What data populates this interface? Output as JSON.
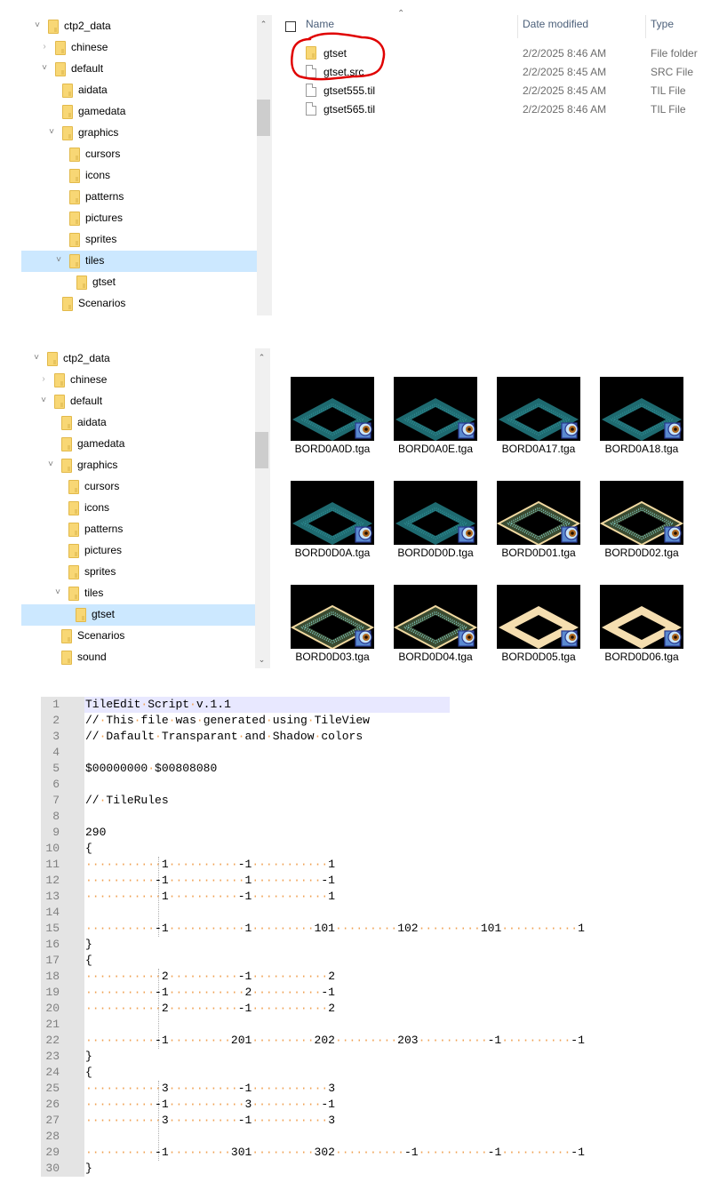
{
  "explorer1": {
    "tree": [
      {
        "label": "ctp2_data",
        "depth": 0,
        "chevron": "expanded"
      },
      {
        "label": "chinese",
        "depth": 1,
        "chevron": "collapsed"
      },
      {
        "label": "default",
        "depth": 1,
        "chevron": "expanded"
      },
      {
        "label": "aidata",
        "depth": 2,
        "chevron": "none"
      },
      {
        "label": "gamedata",
        "depth": 2,
        "chevron": "none"
      },
      {
        "label": "graphics",
        "depth": 2,
        "chevron": "expanded"
      },
      {
        "label": "cursors",
        "depth": 3,
        "chevron": "none"
      },
      {
        "label": "icons",
        "depth": 3,
        "chevron": "none"
      },
      {
        "label": "patterns",
        "depth": 3,
        "chevron": "none"
      },
      {
        "label": "pictures",
        "depth": 3,
        "chevron": "none"
      },
      {
        "label": "sprites",
        "depth": 3,
        "chevron": "none"
      },
      {
        "label": "tiles",
        "depth": 3,
        "chevron": "expanded",
        "selected": true
      },
      {
        "label": "gtset",
        "depth": 4,
        "chevron": "none"
      },
      {
        "label": "Scenarios",
        "depth": 2,
        "chevron": "none"
      }
    ],
    "columns": {
      "name": "Name",
      "date": "Date modified",
      "type": "Type"
    },
    "files": [
      {
        "name": "gtset",
        "date": "2/2/2025 8:46 AM",
        "type": "File folder",
        "icon": "folder-icon"
      },
      {
        "name": "gtset.src",
        "date": "2/2/2025 8:45 AM",
        "type": "SRC File",
        "icon": "file-icon"
      },
      {
        "name": "gtset555.til",
        "date": "2/2/2025 8:45 AM",
        "type": "TIL File",
        "icon": "file-icon"
      },
      {
        "name": "gtset565.til",
        "date": "2/2/2025 8:46 AM",
        "type": "TIL File",
        "icon": "file-icon"
      }
    ],
    "annotation": "red hand-drawn circle around gtset and gtset.src"
  },
  "explorer2": {
    "tree": [
      {
        "label": "ctp2_data",
        "depth": 0,
        "chevron": "expanded"
      },
      {
        "label": "chinese",
        "depth": 1,
        "chevron": "collapsed"
      },
      {
        "label": "default",
        "depth": 1,
        "chevron": "expanded"
      },
      {
        "label": "aidata",
        "depth": 2,
        "chevron": "none"
      },
      {
        "label": "gamedata",
        "depth": 2,
        "chevron": "none"
      },
      {
        "label": "graphics",
        "depth": 2,
        "chevron": "expanded"
      },
      {
        "label": "cursors",
        "depth": 3,
        "chevron": "none"
      },
      {
        "label": "icons",
        "depth": 3,
        "chevron": "none"
      },
      {
        "label": "patterns",
        "depth": 3,
        "chevron": "none"
      },
      {
        "label": "pictures",
        "depth": 3,
        "chevron": "none"
      },
      {
        "label": "sprites",
        "depth": 3,
        "chevron": "none"
      },
      {
        "label": "tiles",
        "depth": 3,
        "chevron": "expanded"
      },
      {
        "label": "gtset",
        "depth": 4,
        "chevron": "none",
        "selected": true
      },
      {
        "label": "Scenarios",
        "depth": 2,
        "chevron": "none"
      },
      {
        "label": "sound",
        "depth": 2,
        "chevron": "none"
      }
    ],
    "thumbnails": [
      {
        "name": "BORD0A0D.tga",
        "style": "teal"
      },
      {
        "name": "BORD0A0E.tga",
        "style": "teal"
      },
      {
        "name": "BORD0A17.tga",
        "style": "teal"
      },
      {
        "name": "BORD0A18.tga",
        "style": "teal"
      },
      {
        "name": "BORD0D0A.tga",
        "style": "teal"
      },
      {
        "name": "BORD0D0D.tga",
        "style": "teal"
      },
      {
        "name": "BORD0D01.tga",
        "style": "ornate"
      },
      {
        "name": "BORD0D02.tga",
        "style": "ornate"
      },
      {
        "name": "BORD0D03.tga",
        "style": "ornate"
      },
      {
        "name": "BORD0D04.tga",
        "style": "ornate"
      },
      {
        "name": "BORD0D05.tga",
        "style": "cream"
      },
      {
        "name": "BORD0D06.tga",
        "style": "cream"
      }
    ]
  },
  "editor": {
    "current_line": 1,
    "lines": [
      "TileEdit Script v.1.1",
      "// This file was generated using TileView",
      "// Dafault Transparant and Shadow colors",
      "",
      "$00000000 $00808080",
      "",
      "// TileRules",
      "",
      "290",
      "{",
      "\t   1\t  -1\t   1",
      "\t  -1\t   1\t  -1",
      "\t   1\t  -1\t   1",
      "",
      "\t  -1\t   1\t 101\t 102\t 101\t   1",
      "}",
      "{",
      "\t   2\t  -1\t   2",
      "\t  -1\t   2\t  -1",
      "\t   2\t  -1\t   2",
      "",
      "\t  -1\t 201\t 202\t 203\t  -1\t  -1",
      "}",
      "{",
      "\t   3\t  -1\t   3",
      "\t  -1\t   3\t  -1",
      "\t   3\t  -1\t   3",
      "",
      "\t  -1\t 301\t 302\t  -1\t  -1\t  -1",
      "}"
    ]
  },
  "colors": {
    "selection": "#cce8ff",
    "annotation_red": "#e00000",
    "whitespace_marker": "#f0a050",
    "teal_tile": "#1e6a70",
    "cream_tile": "#f5deb0"
  }
}
